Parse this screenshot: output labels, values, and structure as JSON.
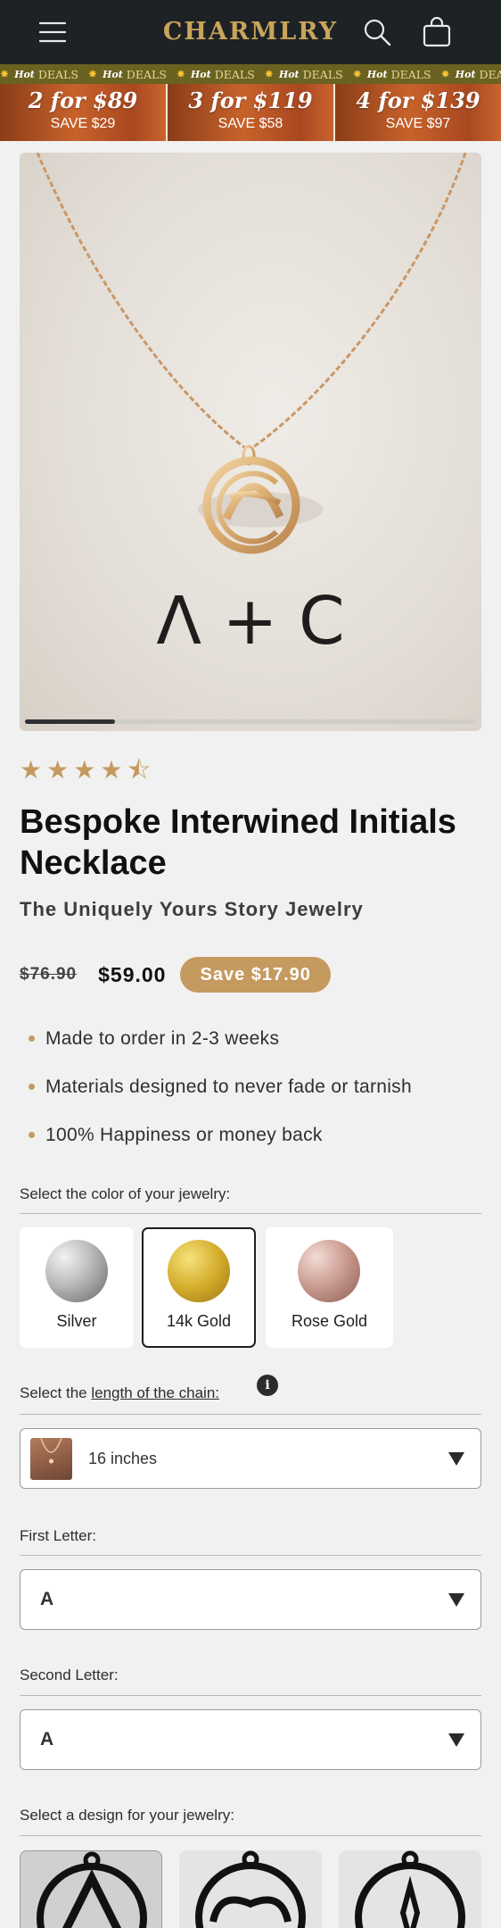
{
  "header": {
    "brand": "CHARMLRY",
    "icons": [
      "menu-icon",
      "search-icon",
      "cart-icon"
    ],
    "background": "#1d2225",
    "brand_color": "#c9a45a"
  },
  "ticker": {
    "items": [
      {
        "hot": "Hot",
        "text": "DEALS"
      },
      {
        "hot": "Hot",
        "text": "DEALS"
      },
      {
        "hot": "Hot",
        "text": "DEALS"
      },
      {
        "hot": "Hot",
        "text": "DEALS"
      },
      {
        "hot": "Hot",
        "text": "DEALS"
      },
      {
        "hot": "Hot",
        "text": "DEALS"
      }
    ]
  },
  "promos": [
    {
      "deal": "2 for $89",
      "save": "SAVE $29"
    },
    {
      "deal": "3 for $119",
      "save": "SAVE $58"
    },
    {
      "deal": "4 for $139",
      "save": "SAVE $97"
    }
  ],
  "gallery": {
    "image_text": "Λ + C",
    "scroll_progress": 0.2
  },
  "product": {
    "rating": 4.5,
    "title": "Bespoke Interwined Initials Necklace",
    "subtitle": "The Uniquely Yours Story Jewelry",
    "old_price": "$76.90",
    "price": "$59.00",
    "save": "Save $17.90",
    "bullets": [
      "Made to order in 2-3 weeks",
      "Materials designed to never fade or tarnish",
      "100% Happiness or money back"
    ]
  },
  "color_section": {
    "label": "Select the color of your jewelry:",
    "options": [
      {
        "name": "Silver",
        "selected": false
      },
      {
        "name": "14k Gold",
        "selected": true
      },
      {
        "name": "Rose Gold",
        "selected": false
      }
    ]
  },
  "chain_section": {
    "label_prefix": "Select the",
    "label_link": "length of the chain:",
    "value": "16 inches"
  },
  "first_letter": {
    "label": "First Letter:",
    "value": "A"
  },
  "second_letter": {
    "label": "Second Letter:",
    "value": "A"
  },
  "design_section": {
    "label": "Select a design for your jewelry:"
  }
}
